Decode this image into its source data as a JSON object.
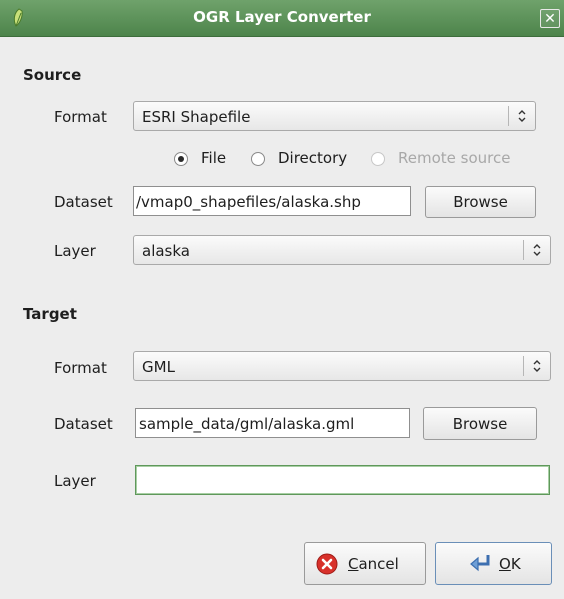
{
  "window": {
    "title": "OGR Layer Converter",
    "close_glyph": "✕"
  },
  "source": {
    "section_title": "Source",
    "format_label": "Format",
    "format_value": "ESRI Shapefile",
    "radio_file": "File",
    "radio_directory": "Directory",
    "radio_remote": "Remote source",
    "selected_radio": "File",
    "dataset_label": "Dataset",
    "dataset_value": "/vmap0_shapefiles/alaska.shp",
    "browse_label": "Browse",
    "layer_label": "Layer",
    "layer_value": "alaska"
  },
  "target": {
    "section_title": "Target",
    "format_label": "Format",
    "format_value": "GML",
    "dataset_label": "Dataset",
    "dataset_value": "sample_data/gml/alaska.gml",
    "browse_label": "Browse",
    "layer_label": "Layer",
    "layer_value": ""
  },
  "buttons": {
    "cancel_mnemonic": "C",
    "cancel_rest": "ancel",
    "ok_mnemonic": "O",
    "ok_rest": "K"
  },
  "icons": {
    "app": "qgis-leaf-icon",
    "cancel": "red-x-circle-icon",
    "ok": "return-arrow-icon",
    "combo_arrow": "updown-arrow-icon"
  },
  "colors": {
    "titlebar": "#5a9156",
    "focus_border": "#5f985b",
    "cancel_icon": "#d8312b"
  }
}
